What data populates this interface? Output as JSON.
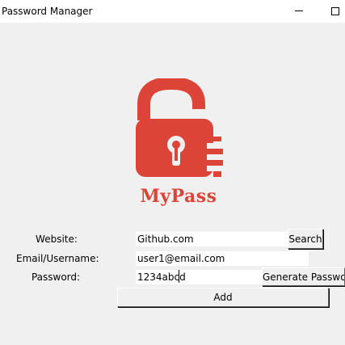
{
  "window": {
    "title": "Password Manager",
    "minimize_icon": "minimize-icon",
    "maximize_icon": "maximize-icon"
  },
  "logo": {
    "icon": "unlocked-padlock-icon",
    "text": "MyPass",
    "color": "#db4437"
  },
  "form": {
    "website_label": "Website:",
    "website_value": "Github.com",
    "search_label": "Search",
    "email_label": "Email/Username:",
    "email_value": "user1@email.com",
    "password_label": "Password:",
    "password_value": "1234abcd",
    "generate_label": "Generate Password",
    "add_label": "Add"
  }
}
